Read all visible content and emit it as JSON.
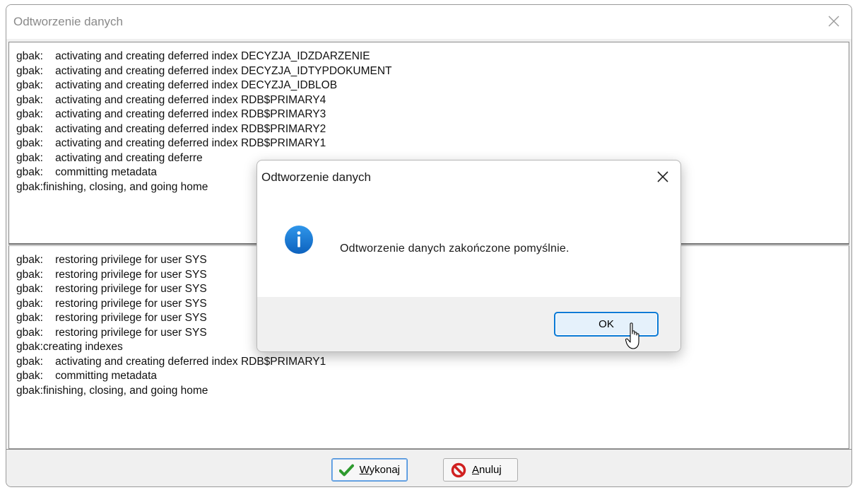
{
  "main_window": {
    "title": "Odtworzenie danych",
    "log_top": [
      "gbak:    activating and creating deferred index DECYZJA_IDZDARZENIE",
      "gbak:    activating and creating deferred index DECYZJA_IDTYPDOKUMENT",
      "gbak:    activating and creating deferred index DECYZJA_IDBLOB",
      "gbak:    activating and creating deferred index RDB$PRIMARY4",
      "gbak:    activating and creating deferred index RDB$PRIMARY3",
      "gbak:    activating and creating deferred index RDB$PRIMARY2",
      "gbak:    activating and creating deferred index RDB$PRIMARY1",
      "gbak:    activating and creating deferre",
      "gbak:    committing metadata",
      "gbak:finishing, closing, and going home"
    ],
    "log_bottom": [
      "gbak:    restoring privilege for user SYS",
      "gbak:    restoring privilege for user SYS",
      "gbak:    restoring privilege for user SYS",
      "gbak:    restoring privilege for user SYS",
      "gbak:    restoring privilege for user SYS",
      "gbak:    restoring privilege for user SYS",
      "gbak:creating indexes",
      "gbak:    activating and creating deferred index RDB$PRIMARY1",
      "gbak:    committing metadata",
      "gbak:finishing, closing, and going home"
    ],
    "buttons": {
      "execute_mnemonic": "W",
      "execute_rest": "ykonaj",
      "cancel_mnemonic": "A",
      "cancel_rest": "nuluj"
    }
  },
  "dialog": {
    "title": "Odtworzenie danych",
    "message": "Odtworzenie danych zakończone pomyślnie.",
    "ok_label": "OK",
    "icon": "info-icon"
  },
  "colors": {
    "info_blue": "#1a78d4",
    "ok_border": "#0a7ad6",
    "check_green": "#2e9a2e",
    "cancel_red": "#d02020"
  }
}
